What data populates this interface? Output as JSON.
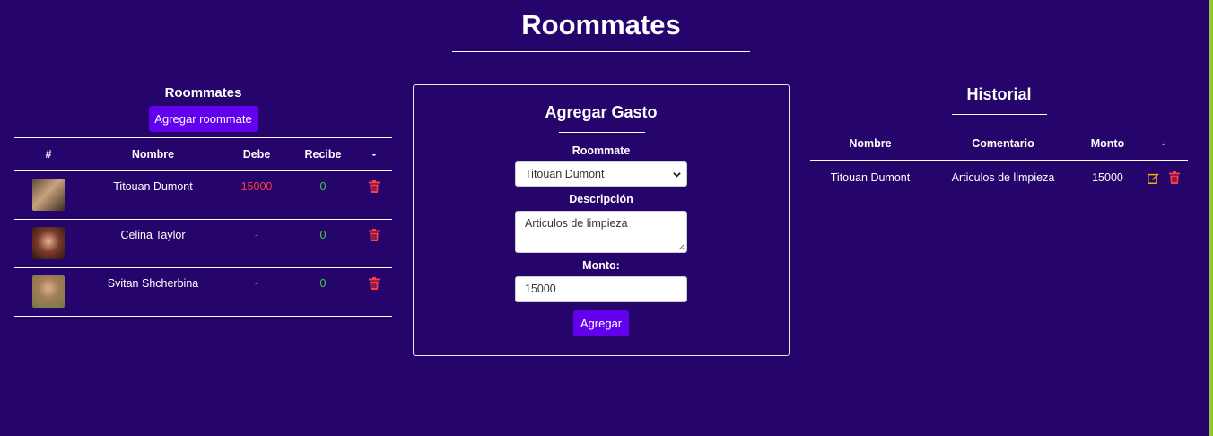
{
  "page": {
    "title": "Roommates",
    "background_color": "#25046b",
    "accent_color": "#6200ee",
    "right_edge_color": "#8fc93a"
  },
  "roommates_section": {
    "heading": "Roommates",
    "add_button_label": "Agregar roommate",
    "columns": [
      "#",
      "Nombre",
      "Debe",
      "Recibe",
      "-"
    ],
    "rows": [
      {
        "name": "Titouan Dumont",
        "debe": "15000",
        "recibe": "0",
        "avatar_icon": "avatar-photo"
      },
      {
        "name": "Celina Taylor",
        "debe": "-",
        "recibe": "0",
        "avatar_icon": "avatar-photo"
      },
      {
        "name": "Svitan Shcherbina",
        "debe": "-",
        "recibe": "0",
        "avatar_icon": "avatar-photo"
      }
    ],
    "debe_color": "#ff3b3b",
    "recibe_color": "#3ecf3e",
    "delete_icon": "trash-icon"
  },
  "gasto_form": {
    "title": "Agregar Gasto",
    "roommate_label": "Roommate",
    "roommate_selected": "Titouan Dumont",
    "descripcion_label": "Descripción",
    "descripcion_value": "Articulos de limpieza",
    "monto_label": "Monto:",
    "monto_value": "15000",
    "submit_label": "Agregar"
  },
  "historial": {
    "title": "Historial",
    "columns": [
      "Nombre",
      "Comentario",
      "Monto",
      "-"
    ],
    "rows": [
      {
        "nombre": "Titouan Dumont",
        "comentario": "Articulos de limpieza",
        "monto": "15000"
      }
    ],
    "edit_icon": "edit-icon",
    "edit_color": "#f5b300",
    "delete_icon": "trash-icon",
    "delete_color": "#ff3b3b"
  }
}
